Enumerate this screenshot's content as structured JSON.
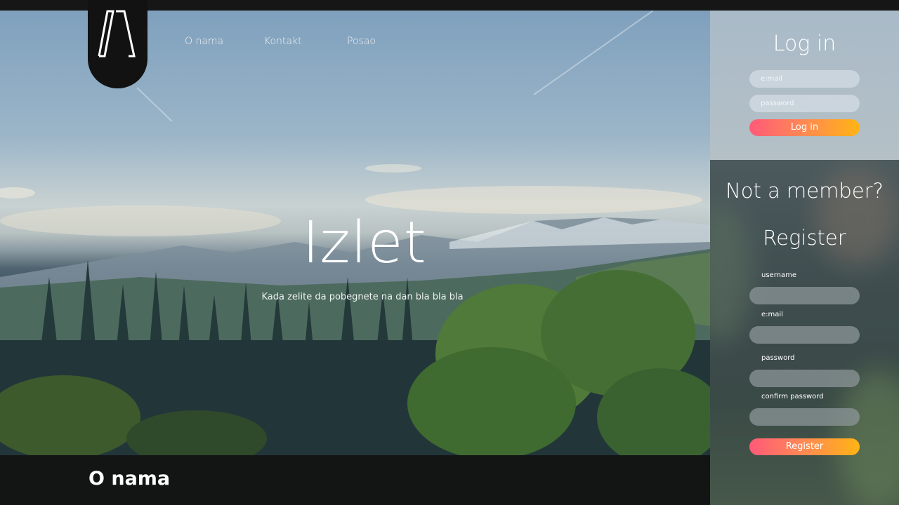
{
  "nav": {
    "items": [
      "O nama",
      "Kontakt",
      "Posao"
    ]
  },
  "hero": {
    "title": "Izlet",
    "subtitle": "Kada zelite da pobegnete na dan bla bla bla"
  },
  "footer": {
    "section_title": "O nama"
  },
  "login": {
    "title": "Log in",
    "email_placeholder": "e:mail",
    "password_placeholder": "password",
    "button": "Log in"
  },
  "register": {
    "prompt": "Not a member?",
    "title": "Register",
    "fields": [
      {
        "label": "username",
        "value": ""
      },
      {
        "label": "e:mail",
        "value": ""
      },
      {
        "label": "password",
        "value": ""
      },
      {
        "label": "confirm password",
        "value": ""
      }
    ],
    "button": "Register"
  },
  "colors": {
    "button_gradient_start": "#ff5a78",
    "button_gradient_end": "#ffb414",
    "topbar": "#161616"
  }
}
